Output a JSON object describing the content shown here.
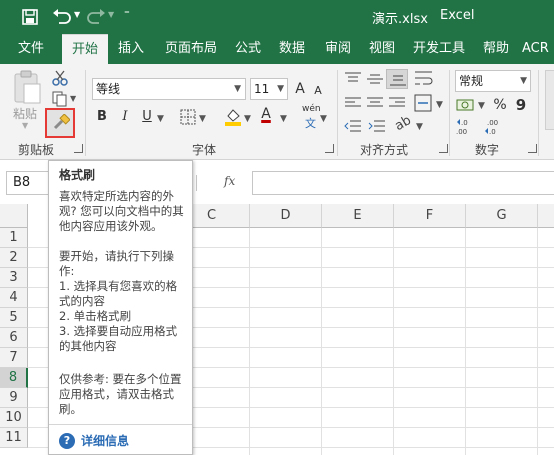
{
  "titlebar": {
    "filename": "演示.xlsx",
    "app": "Excel",
    "save_icon": "save-icon",
    "undo_icon": "undo-icon",
    "redo_icon": "redo-icon",
    "customize_icon": "customize-quick-access-icon"
  },
  "tabs": [
    "文件",
    "开始",
    "插入",
    "页面布局",
    "公式",
    "数据",
    "审阅",
    "视图",
    "开发工具",
    "帮助",
    "ACR"
  ],
  "active_tab": "开始",
  "ribbon": {
    "clipboard": {
      "paste_label": "粘贴",
      "group_label": "剪贴板"
    },
    "font": {
      "font_name": "等线",
      "font_size": "11",
      "bold": "B",
      "italic": "I",
      "underline": "U",
      "phonetic": "wén",
      "font_color_letter": "A",
      "grow": "A",
      "shrink": "A",
      "group_label": "字体"
    },
    "alignment": {
      "group_label": "对齐方式"
    },
    "number": {
      "format": "常规",
      "percent": "%",
      "comma": "9",
      "group_label": "数字"
    }
  },
  "formula_bar": {
    "name_box": "B8",
    "fx": "fx",
    "formula": ""
  },
  "grid": {
    "columns": [
      "C",
      "D",
      "E",
      "F",
      "G"
    ],
    "rows": [
      "1",
      "2",
      "3",
      "4",
      "5",
      "6",
      "7",
      "8",
      "9",
      "10",
      "11"
    ],
    "selected_row": "8"
  },
  "tooltip": {
    "title": "格式刷",
    "desc": "喜欢特定所选内容的外观? 您可以向文档中的其他内容应用该外观。",
    "steps": "要开始，请执行下列操作:\n1. 选择具有您喜欢的格式的内容\n2. 单击格式刷\n3. 选择要自动应用格式的其他内容",
    "note": "仅供参考: 要在多个位置应用格式，请双击格式刷。",
    "help_link": "详细信息",
    "help_icon": "help-icon"
  },
  "colors": {
    "accent": "#217346",
    "highlight_box": "#e53935",
    "font_color": "#c00000",
    "fill_color": "#ffcc00"
  }
}
